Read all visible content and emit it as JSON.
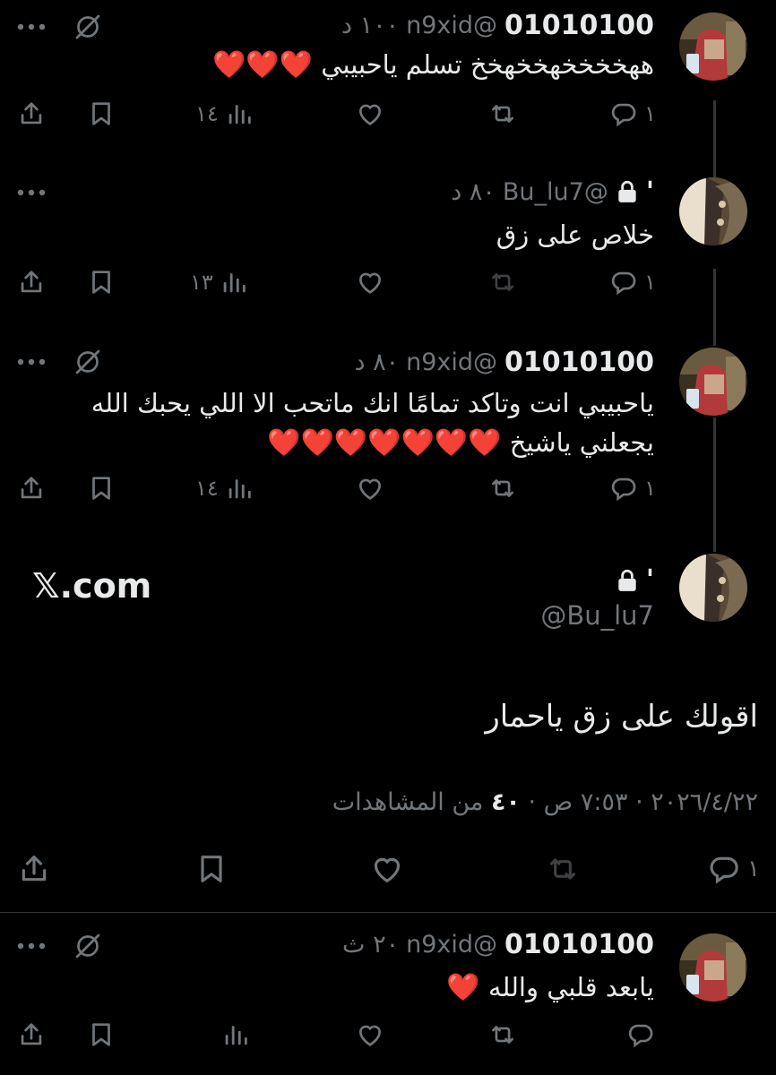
{
  "replies": [
    {
      "display_name": "01010100",
      "handle": "@n9xid",
      "time": "١٠٠ د",
      "text": "ههخخخخهخخهخخ تسلم ياحبيبي",
      "hearts": "❤️❤️❤️",
      "reply_count": "١",
      "views": "١٤",
      "icon": "grok-icon"
    },
    {
      "display_name": "'",
      "handle": "@Bu_lu7",
      "time": "٨٠ د",
      "text": "خلاص على زق",
      "hearts": "",
      "reply_count": "١",
      "views": "١٣",
      "icon": "none"
    },
    {
      "display_name": "01010100",
      "handle": "@n9xid",
      "time": "٨٠ د",
      "text": "ياحبيبي انت وتاكد تمامًا انك ماتحب الا اللي يحبك الله يجعلني ياشيخ",
      "hearts": "❤️❤️❤️❤️❤️❤️❤️",
      "reply_count": "١",
      "views": "١٤",
      "icon": "grok-icon"
    }
  ],
  "main_tweet": {
    "brand": "𝕏.com",
    "display_name": "'",
    "handle": "@Bu_lu7",
    "text": "اقولك على زق ياحمار",
    "date": "٢٠٢٦/٤/٢٢",
    "time": "٧:٥٣ ص",
    "views": "٤٠",
    "views_label": "من المشاهدات",
    "reply_count": "١"
  },
  "last_reply": {
    "display_name": "01010100",
    "handle": "@n9xid",
    "time": "٢٠ ث",
    "text": "يابعد قلبي والله",
    "hearts": "❤️",
    "icon": "grok-icon"
  },
  "colors": {
    "background": "#000000",
    "text": "#e7e9ea",
    "muted": "#71767b",
    "heart": "#f01a2a"
  }
}
